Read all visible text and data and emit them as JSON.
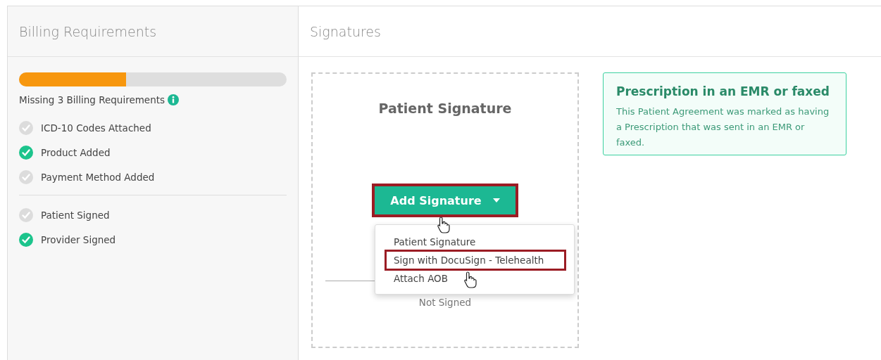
{
  "billing": {
    "title": "Billing Requirements",
    "progress": {
      "level": 0.4
    },
    "summary": "Missing 3 Billing Requirements",
    "groups": [
      [
        {
          "label": "ICD-10 Codes Attached",
          "done": false
        },
        {
          "label": "Product Added",
          "done": true
        },
        {
          "label": "Payment Method Added",
          "done": false
        }
      ],
      [
        {
          "label": "Patient Signed",
          "done": false
        },
        {
          "label": "Provider Signed",
          "done": true
        }
      ]
    ]
  },
  "signatures": {
    "title": "Signatures",
    "card": {
      "title": "Patient Signature",
      "status": "Not Signed",
      "button": {
        "label": "Add Signature",
        "highlighted": true,
        "expanded": true
      },
      "menu": [
        {
          "label": "Patient Signature",
          "highlighted": false
        },
        {
          "label": "Sign with DocuSign - Telehealth",
          "highlighted": true
        },
        {
          "label": "Attach AOB",
          "highlighted": false
        }
      ]
    },
    "notice": {
      "title": "Prescription in an EMR or faxed",
      "text": "This Patient Agreement was marked as having a Prescription that was sent in an EMR or faxed."
    }
  }
}
